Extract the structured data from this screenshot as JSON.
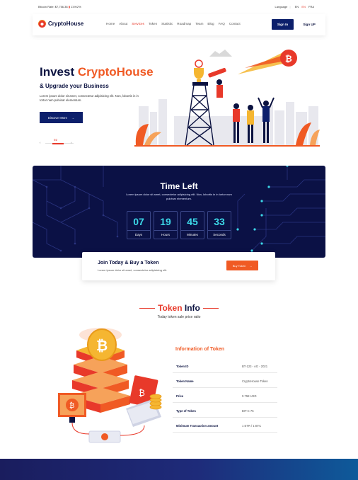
{
  "topbar": {
    "bitcoin_rate": "Bitcoin Rate: $7,756.38",
    "change": "11%/2%",
    "language_label": "Language",
    "languages": [
      "EN",
      "EN",
      "FRA"
    ]
  },
  "header": {
    "logo_text": "CryptoHouse",
    "nav": [
      "Home",
      "About",
      "Services",
      "Token",
      "Statistic",
      "Roadmap",
      "Team",
      "Blog",
      "FAQ",
      "Contact"
    ],
    "active_nav": "Services",
    "signin_label": "Sign In",
    "signup_label": "Sign UP"
  },
  "hero": {
    "title_part1": "Invest ",
    "title_part2": "CryptoHouse",
    "subtitle": "& Upgrade your Business",
    "text": "Lorem ipsum dolor sit amet, consectetur adipisicing elit. Non, lobortis in in tortor nam pulvinar elementum.",
    "button_label": "Discover More",
    "slide_number": "02",
    "prev_icon": "‹",
    "next_icon": "›",
    "arrow": "→"
  },
  "countdown": {
    "title": "Time Left",
    "text": "Lorem ipsum dolor sit amet, consectetur adipisicing elit. Non, lobortis in in tortor nam pulvinar elementum.",
    "items": [
      {
        "value": "07",
        "label": "Days"
      },
      {
        "value": "19",
        "label": "Hours"
      },
      {
        "value": "45",
        "label": "Minutes"
      },
      {
        "value": "33",
        "label": "Seconds"
      }
    ]
  },
  "join": {
    "title": "Join Today & Buy a Token",
    "text": "Lorem ipsum dolor sit amet, consectetur adipisicing elit.",
    "button_label": "Buy Token",
    "arrow": "→"
  },
  "token": {
    "title_red": "Token",
    "title_navy": "Info",
    "subtitle": "Today token sale price ratio",
    "info_title": "Information of Token",
    "rows": [
      {
        "key": "Token ID",
        "value": "BT-123 - AG - 2021"
      },
      {
        "key": "Token Name",
        "value": "CryptoHouse Token"
      },
      {
        "key": "Price",
        "value": "0.758 USD"
      },
      {
        "key": "Type of Token",
        "value": "BIT-C 75"
      },
      {
        "key": "Minimum Transaction amount",
        "value": "1 ETR / 1 BTC"
      }
    ]
  },
  "colors": {
    "navy": "#0b1240",
    "accent_orange": "#f05a24",
    "accent_red": "#e8392a",
    "cyan": "#3cd8e8"
  }
}
